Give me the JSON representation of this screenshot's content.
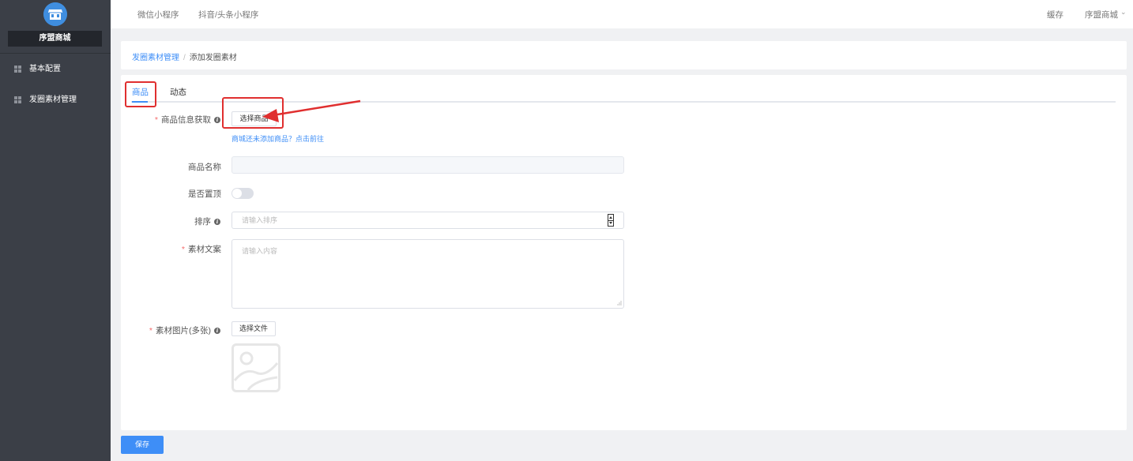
{
  "sidebar": {
    "store_name": "序盟商城",
    "items": [
      {
        "label": "基本配置",
        "icon": "grid-icon"
      },
      {
        "label": "发圈素材管理",
        "icon": "grid-icon"
      }
    ]
  },
  "topbar": {
    "links": [
      "微信小程序",
      "抖音/头条小程序"
    ],
    "cache": "缓存",
    "user": "序盟商城"
  },
  "breadcrumb": {
    "parent": "发圈素材管理",
    "separator": "/",
    "current": "添加发圈素材"
  },
  "tabs": [
    "商品",
    "动态"
  ],
  "form": {
    "product_info_label": "商品信息获取",
    "select_product_button": "选择商品",
    "help_link": "商城还未添加商品？点击前往",
    "product_name_label": "商品名称",
    "pin_top_label": "是否置顶",
    "pin_top_value": false,
    "sort_label": "排序",
    "sort_placeholder": "请输入排序",
    "copy_label": "素材文案",
    "copy_placeholder": "请输入内容",
    "images_label": "素材图片(多张)",
    "select_file_button": "选择文件"
  },
  "save_button": "保存",
  "colors": {
    "primary": "#3e8ef7",
    "sidebar": "#3b3f47",
    "required": "#f56c6c",
    "annotation": "#e02f2f"
  }
}
